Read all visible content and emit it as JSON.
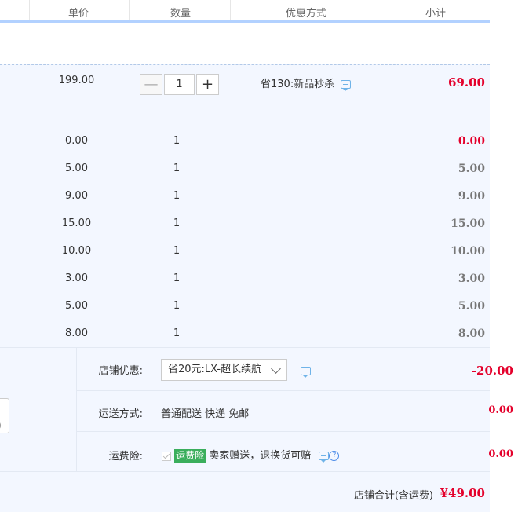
{
  "header": {
    "col_price": "单价",
    "col_qty": "数量",
    "col_promo": "优惠方式",
    "col_subtotal": "小计"
  },
  "main_item": {
    "price": "199.00",
    "quantity": "1",
    "minus": "—",
    "plus": "+",
    "promo": "省130:新品秒杀",
    "subtotal": "69.00"
  },
  "items": [
    {
      "price": "0.00",
      "quantity": "1",
      "subtotal": "0.00",
      "highlight": true
    },
    {
      "price": "5.00",
      "quantity": "1",
      "subtotal": "5.00",
      "highlight": false
    },
    {
      "price": "9.00",
      "quantity": "1",
      "subtotal": "9.00",
      "highlight": false
    },
    {
      "price": "15.00",
      "quantity": "1",
      "subtotal": "15.00",
      "highlight": false
    },
    {
      "price": "10.00",
      "quantity": "1",
      "subtotal": "10.00",
      "highlight": false
    },
    {
      "price": "3.00",
      "quantity": "1",
      "subtotal": "3.00",
      "highlight": false
    },
    {
      "price": "5.00",
      "quantity": "1",
      "subtotal": "5.00",
      "highlight": false
    },
    {
      "price": "8.00",
      "quantity": "1",
      "subtotal": "8.00",
      "highlight": false
    }
  ],
  "shop": {
    "discount_label": "店铺优惠:",
    "discount_select": "省20元:LX-超长续航",
    "discount_amount": "-20.00",
    "shipping_label": "运送方式:",
    "shipping_value": "普通配送 快递 免邮",
    "shipping_amount": "0.00",
    "insurance_label": "运费险:",
    "insurance_badge": "运费险",
    "insurance_text": "卖家赠送，退换货可赔",
    "insurance_amount": "0.00",
    "left_box_char": ")"
  },
  "total": {
    "label": "店铺合计(含运费)",
    "amount": "¥49.00"
  },
  "colors": {
    "accent_red": "#e4002b",
    "badge_green": "#3aae5c",
    "header_line": "#b2d1ff",
    "bg_blue": "#f3f7ff"
  },
  "icons": [
    "chat-icon",
    "question-icon",
    "checkbox-checked-icon",
    "chevron-down-icon"
  ]
}
